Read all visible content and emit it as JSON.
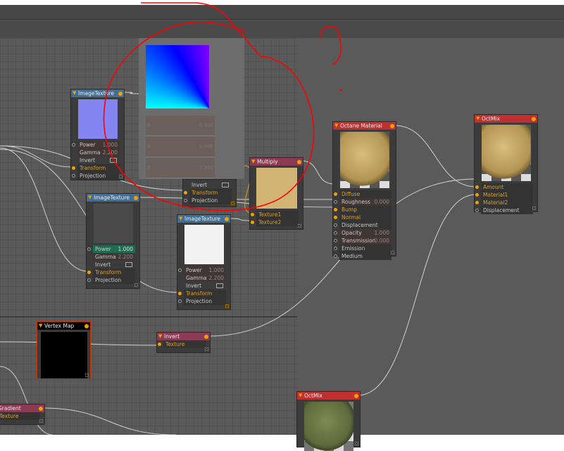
{
  "colors": {
    "accent": "#f0a000",
    "texture_header": "#3f6e96",
    "math_header": "#8a3a52",
    "material_header": "#c03030",
    "annotation": "#ff0000"
  },
  "color_picker": {
    "rows": [
      {
        "label": "R",
        "value": "0.900"
      },
      {
        "label": "G",
        "value": "0.900"
      },
      {
        "label": "B",
        "value": "0.900"
      }
    ]
  },
  "nodes": [
    {
      "id": "img1",
      "title": "ImageTexture",
      "header": "#3f6e96",
      "preview": "#8484f2",
      "rows": [
        {
          "label": "Power",
          "value": "1.000",
          "socket": "off",
          "style": "val"
        },
        {
          "label": "Gamma",
          "value": "2.200",
          "socket": "none",
          "style": "val"
        },
        {
          "label": "Invert",
          "check": true,
          "socket": "none"
        },
        {
          "label": "Transform",
          "socket": "in",
          "style": "bg",
          "active": true
        },
        {
          "label": "Projection",
          "socket": "off",
          "style": "bg"
        }
      ]
    },
    {
      "id": "hidden",
      "title": "",
      "header": "#3b3b3b",
      "rows": [
        {
          "label": "Invert",
          "check": true,
          "socket": "none"
        },
        {
          "label": "Transform",
          "socket": "in",
          "style": "bg",
          "active": true
        },
        {
          "label": "Projection",
          "socket": "off",
          "style": "bg"
        }
      ]
    },
    {
      "id": "img2",
      "title": "ImageTexture",
      "header": "#3f6e96",
      "preview": "#4a4a4a",
      "rows": [
        {
          "label": "Power",
          "value": "1.000",
          "socket": "off",
          "style": "hl"
        },
        {
          "label": "Gamma",
          "value": "2.200",
          "socket": "none",
          "style": "val"
        },
        {
          "label": "Invert",
          "check": true,
          "socket": "none"
        },
        {
          "label": "Transform",
          "socket": "in",
          "style": "bg",
          "active": true
        },
        {
          "label": "Projection",
          "socket": "off",
          "style": "bg"
        }
      ]
    },
    {
      "id": "img3",
      "title": "ImageTexture",
      "header": "#3f6e96",
      "preview": "#f2f2f2",
      "rows": [
        {
          "label": "Power",
          "value": "1.000",
          "socket": "off",
          "style": "val"
        },
        {
          "label": "Gamma",
          "value": "2.200",
          "socket": "none",
          "style": "val"
        },
        {
          "label": "Invert",
          "check": true,
          "socket": "none"
        },
        {
          "label": "Transform",
          "socket": "in",
          "style": "bg",
          "active": true
        },
        {
          "label": "Projection",
          "socket": "off",
          "style": "bg"
        }
      ]
    },
    {
      "id": "multiply",
      "title": "Multiply",
      "header": "#8a3a52",
      "preview": "#d2b574",
      "rows": [
        {
          "label": "Texture1",
          "socket": "in",
          "style": "bg",
          "active": true
        },
        {
          "label": "Texture2",
          "socket": "in",
          "style": "bg",
          "active": true
        }
      ]
    },
    {
      "id": "octane",
      "title": "Octane Material",
      "header": "#c03030",
      "preview": "sphere-sand",
      "rows": [
        {
          "label": "Diffuse",
          "socket": "in",
          "style": "bg",
          "active": true
        },
        {
          "label": "Roughness",
          "value": "0.000",
          "socket": "off",
          "style": "val"
        },
        {
          "label": "Bump",
          "socket": "in",
          "style": "bg",
          "active": true
        },
        {
          "label": "Normal",
          "socket": "in",
          "style": "bg",
          "active": true
        },
        {
          "label": "Displacement",
          "socket": "off",
          "style": "bg"
        },
        {
          "label": "Opacity",
          "value": "1.000",
          "socket": "off",
          "style": "val"
        },
        {
          "label": "Transmission",
          "value": "0.000",
          "socket": "off",
          "style": "val"
        },
        {
          "label": "Emission",
          "socket": "off",
          "style": "bg"
        },
        {
          "label": "Medium",
          "socket": "off",
          "style": "bg"
        }
      ]
    },
    {
      "id": "octmix",
      "title": "OctMix",
      "header": "#c03030",
      "preview": "sphere-sand",
      "rows": [
        {
          "label": "Amount",
          "socket": "in",
          "style": "bg",
          "active": true
        },
        {
          "label": "Material1",
          "socket": "in",
          "style": "bg",
          "active": true
        },
        {
          "label": "Material2",
          "socket": "in",
          "style": "bg",
          "active": true
        },
        {
          "label": "Displacement",
          "socket": "off",
          "style": "bg"
        }
      ]
    },
    {
      "id": "vertex",
      "title": "Vertex Map",
      "header": "#000000",
      "preview": "#000000",
      "rows": []
    },
    {
      "id": "invert",
      "title": "Invert",
      "header": "#8a3a52",
      "rows": [
        {
          "label": "Texture",
          "socket": "in",
          "style": "bg",
          "active": true
        }
      ]
    },
    {
      "id": "gradient",
      "title": "Gradient",
      "header": "#8a3a52",
      "rows": [
        {
          "label": "Texture",
          "socket": "in",
          "style": "bg",
          "active": true
        }
      ]
    },
    {
      "id": "octmix2",
      "title": "OctMix",
      "header": "#c03030",
      "preview": "sphere-moss",
      "rows": []
    }
  ]
}
